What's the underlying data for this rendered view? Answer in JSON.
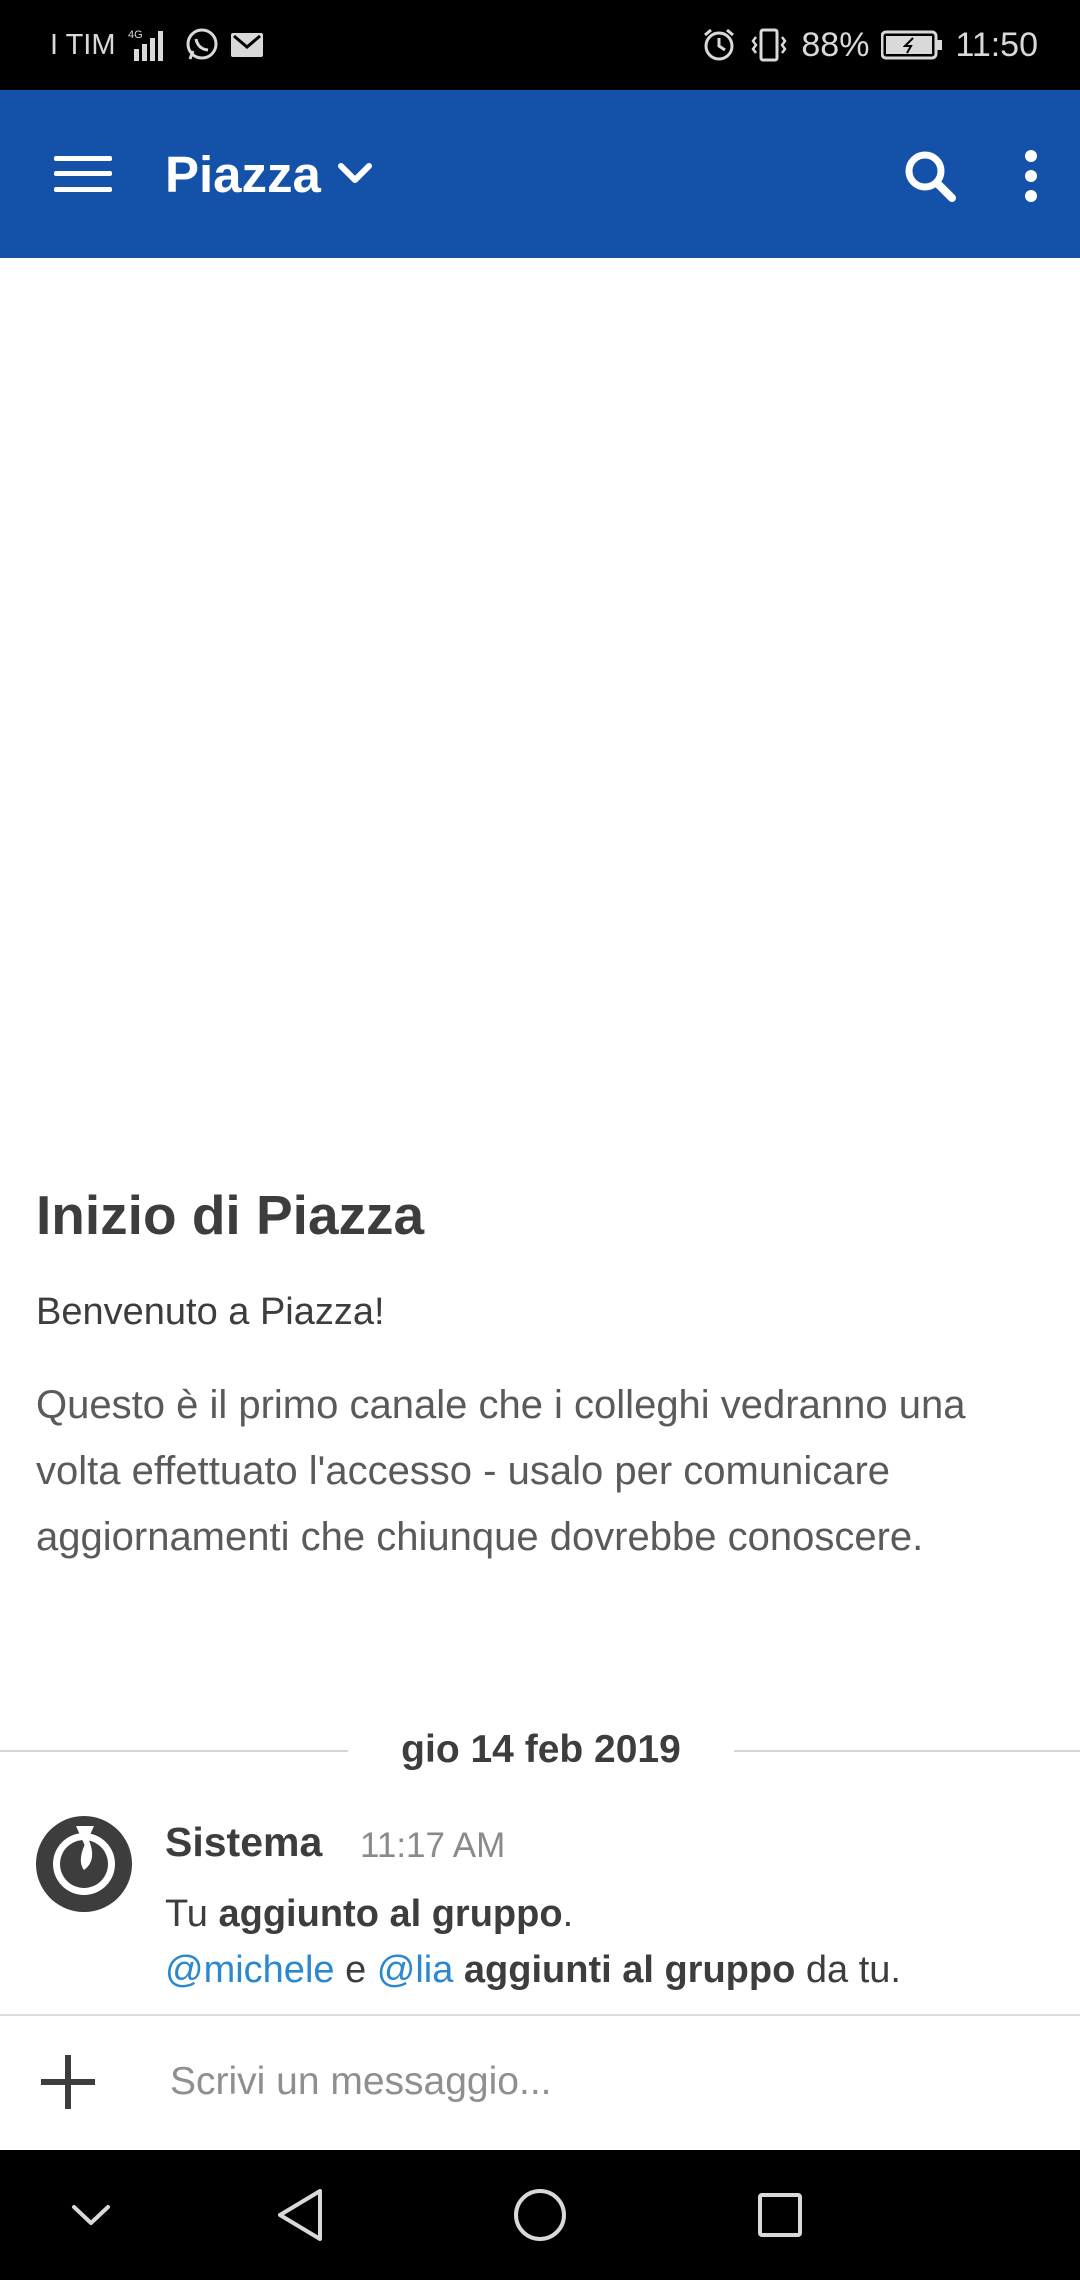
{
  "status_bar": {
    "carrier": "I TIM",
    "network": "4G",
    "battery": "88%",
    "time": "11:50",
    "icons": [
      "signal-icon",
      "whatsapp-icon",
      "gmail-icon",
      "alarm-icon",
      "vibrate-icon",
      "battery-icon"
    ]
  },
  "app_bar": {
    "title": "Piazza",
    "icons": [
      "hamburger-menu-icon",
      "chevron-down-icon",
      "search-icon",
      "more-vert-icon"
    ]
  },
  "intro": {
    "title": "Inizio di Piazza",
    "welcome": "Benvenuto a Piazza!",
    "description": "Questo è il primo canale che i colleghi vedranno una volta effettuato l'accesso - usalo per comunicare aggiornamenti che chiunque dovrebbe conoscere."
  },
  "date_separator": "gio 14 feb 2019",
  "post": {
    "author": "Sistema",
    "time": "11:17 AM",
    "line1": {
      "prefix": "Tu ",
      "bold": "aggiunto al gruppo",
      "suffix": "."
    },
    "line2": {
      "mention1": "@michele",
      "conj": " e ",
      "mention2": "@lia",
      "bold": " aggiunti al gruppo",
      "suffix": " da tu."
    },
    "avatar_icon": "mattermost-logo-icon"
  },
  "composer": {
    "placeholder": "Scrivi un messaggio...",
    "value": "",
    "attach_icon": "plus-icon"
  },
  "nav_bar": {
    "icons": [
      "hide-keyboard-icon",
      "back-icon",
      "home-icon",
      "recents-icon"
    ]
  },
  "colors": {
    "app_bar": "#1451a8",
    "mention": "#2a88d0",
    "text": "#3d3d3d"
  }
}
